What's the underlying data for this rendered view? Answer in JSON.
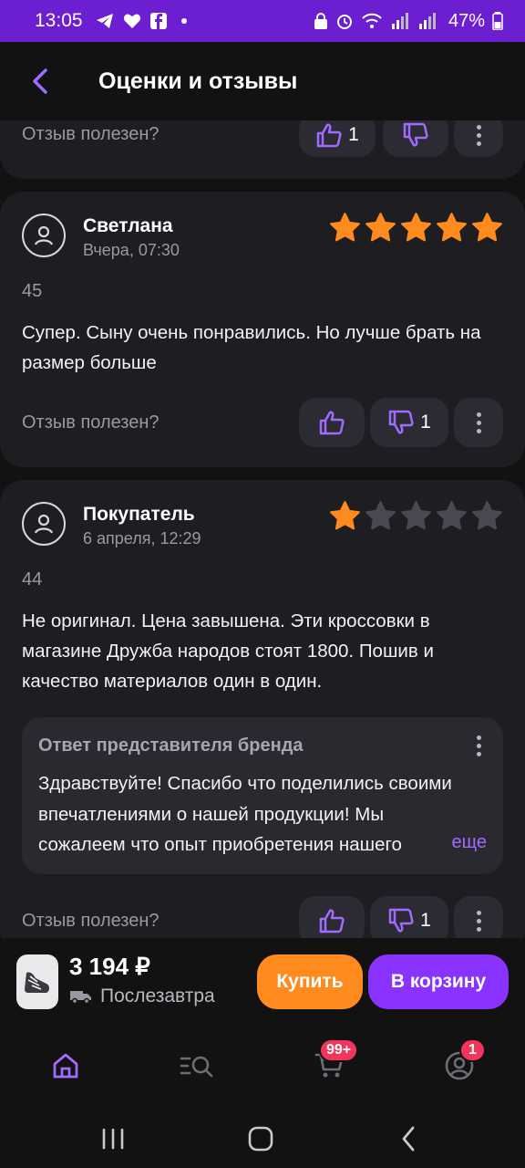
{
  "status_bar": {
    "time": "13:05",
    "battery": "47%"
  },
  "app_bar": {
    "title": "Оценки и отзывы"
  },
  "colors": {
    "accent": "#8a33ff",
    "status_bar": "#6b1fd1",
    "star_active": "#ff8a1e",
    "star_inactive": "#4a4952",
    "buy": "#ff8a1e",
    "badge": "#f2355b"
  },
  "reviews": [
    {
      "helpful_label": "Отзыв полезен?",
      "likes": "1",
      "dislikes": ""
    },
    {
      "author": "Светлана",
      "date": "Вчера, 07:30",
      "rating": 5,
      "size": "45",
      "text": "Супер. Сыну очень понравились. Но лучше брать на размер больше",
      "helpful_label": "Отзыв полезен?",
      "likes": "",
      "dislikes": "1"
    },
    {
      "author": "Покупатель",
      "date": "6 апреля, 12:29",
      "rating": 1,
      "size": "44",
      "text": "Не оригинал. Цена завышена. Эти кроссовки в магазине Дружба народов стоят 1800. Пошив и качество материалов один в один.",
      "brand_reply": {
        "title": "Ответ представителя бренда",
        "text": "Здравствуйте! Спасибо что поделились своими впечатлениями о нашей продукции! Мы сожалеем что опыт приобретения нашего",
        "more": "еще"
      },
      "helpful_label": "Отзыв полезен?",
      "likes": "",
      "dislikes": "1"
    }
  ],
  "buy_bar": {
    "price": "3 194 ₽",
    "delivery": "Послезавтра",
    "buy_label": "Купить",
    "cart_label": "В корзину"
  },
  "tab_bar": {
    "items": [
      "home-icon",
      "catalog-search-icon",
      "cart-icon",
      "profile-icon"
    ],
    "cart_badge": "99+",
    "profile_badge": "1"
  }
}
